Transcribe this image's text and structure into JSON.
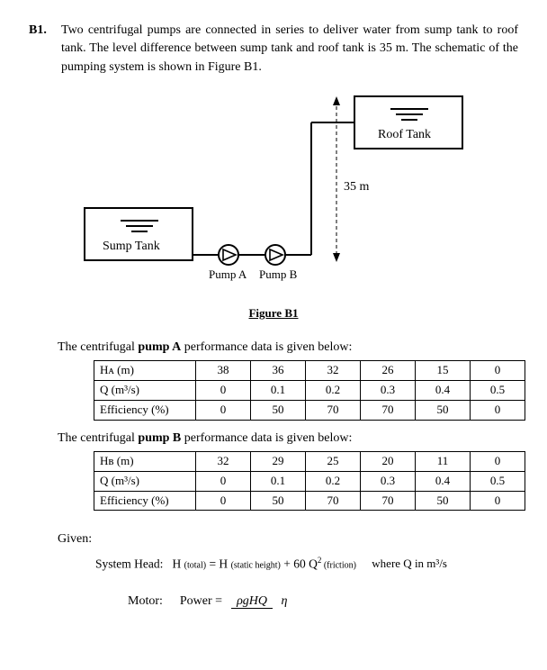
{
  "question_number": "B1.",
  "question_text": "Two centrifugal pumps are connected in series to deliver water from sump tank to roof tank. The level difference between sump tank and roof tank is 35 m. The schematic of the pumping system is shown in Figure B1.",
  "figure": {
    "sump_label": "Sump Tank",
    "roof_label": "Roof Tank",
    "pump_a_label": "Pump A",
    "pump_b_label": "Pump B",
    "height_label": "35 m",
    "caption": "Figure B1"
  },
  "tableA_intro_pre": "The centrifugal ",
  "tableA_intro_bold": "pump A",
  "tableA_intro_post": " performance data is given below:",
  "tableA": {
    "row_h_label": "Hᴀ (m)",
    "row_q_label": "Q (m³/s)",
    "row_e_label": "Efficiency (%)",
    "H": [
      "38",
      "36",
      "32",
      "26",
      "15",
      "0"
    ],
    "Q": [
      "0",
      "0.1",
      "0.2",
      "0.3",
      "0.4",
      "0.5"
    ],
    "E": [
      "0",
      "50",
      "70",
      "70",
      "50",
      "0"
    ]
  },
  "tableB_intro_pre": "The centrifugal ",
  "tableB_intro_bold": "pump B",
  "tableB_intro_post": " performance data is given below:",
  "tableB": {
    "row_h_label": "Hʙ (m)",
    "row_q_label": "Q (m³/s)",
    "row_e_label": "Efficiency (%)",
    "H": [
      "32",
      "29",
      "25",
      "20",
      "11",
      "0"
    ],
    "Q": [
      "0",
      "0.1",
      "0.2",
      "0.3",
      "0.4",
      "0.5"
    ],
    "E": [
      "0",
      "50",
      "70",
      "70",
      "50",
      "0"
    ]
  },
  "given_label": "Given:",
  "system_head": {
    "label": "System Head:",
    "lhs": "H ",
    "lhs_sub": "(total)",
    "eq": " = H ",
    "rhs1_sub": "(static height)",
    "plus": " + 60 Q",
    "sq": "2",
    "rhs2_sub": " (friction)",
    "where": "where Q in m³/s"
  },
  "motor": {
    "label": "Motor:",
    "power_label": "Power = ",
    "numerator": "ρgHQ",
    "denominator": "η"
  }
}
